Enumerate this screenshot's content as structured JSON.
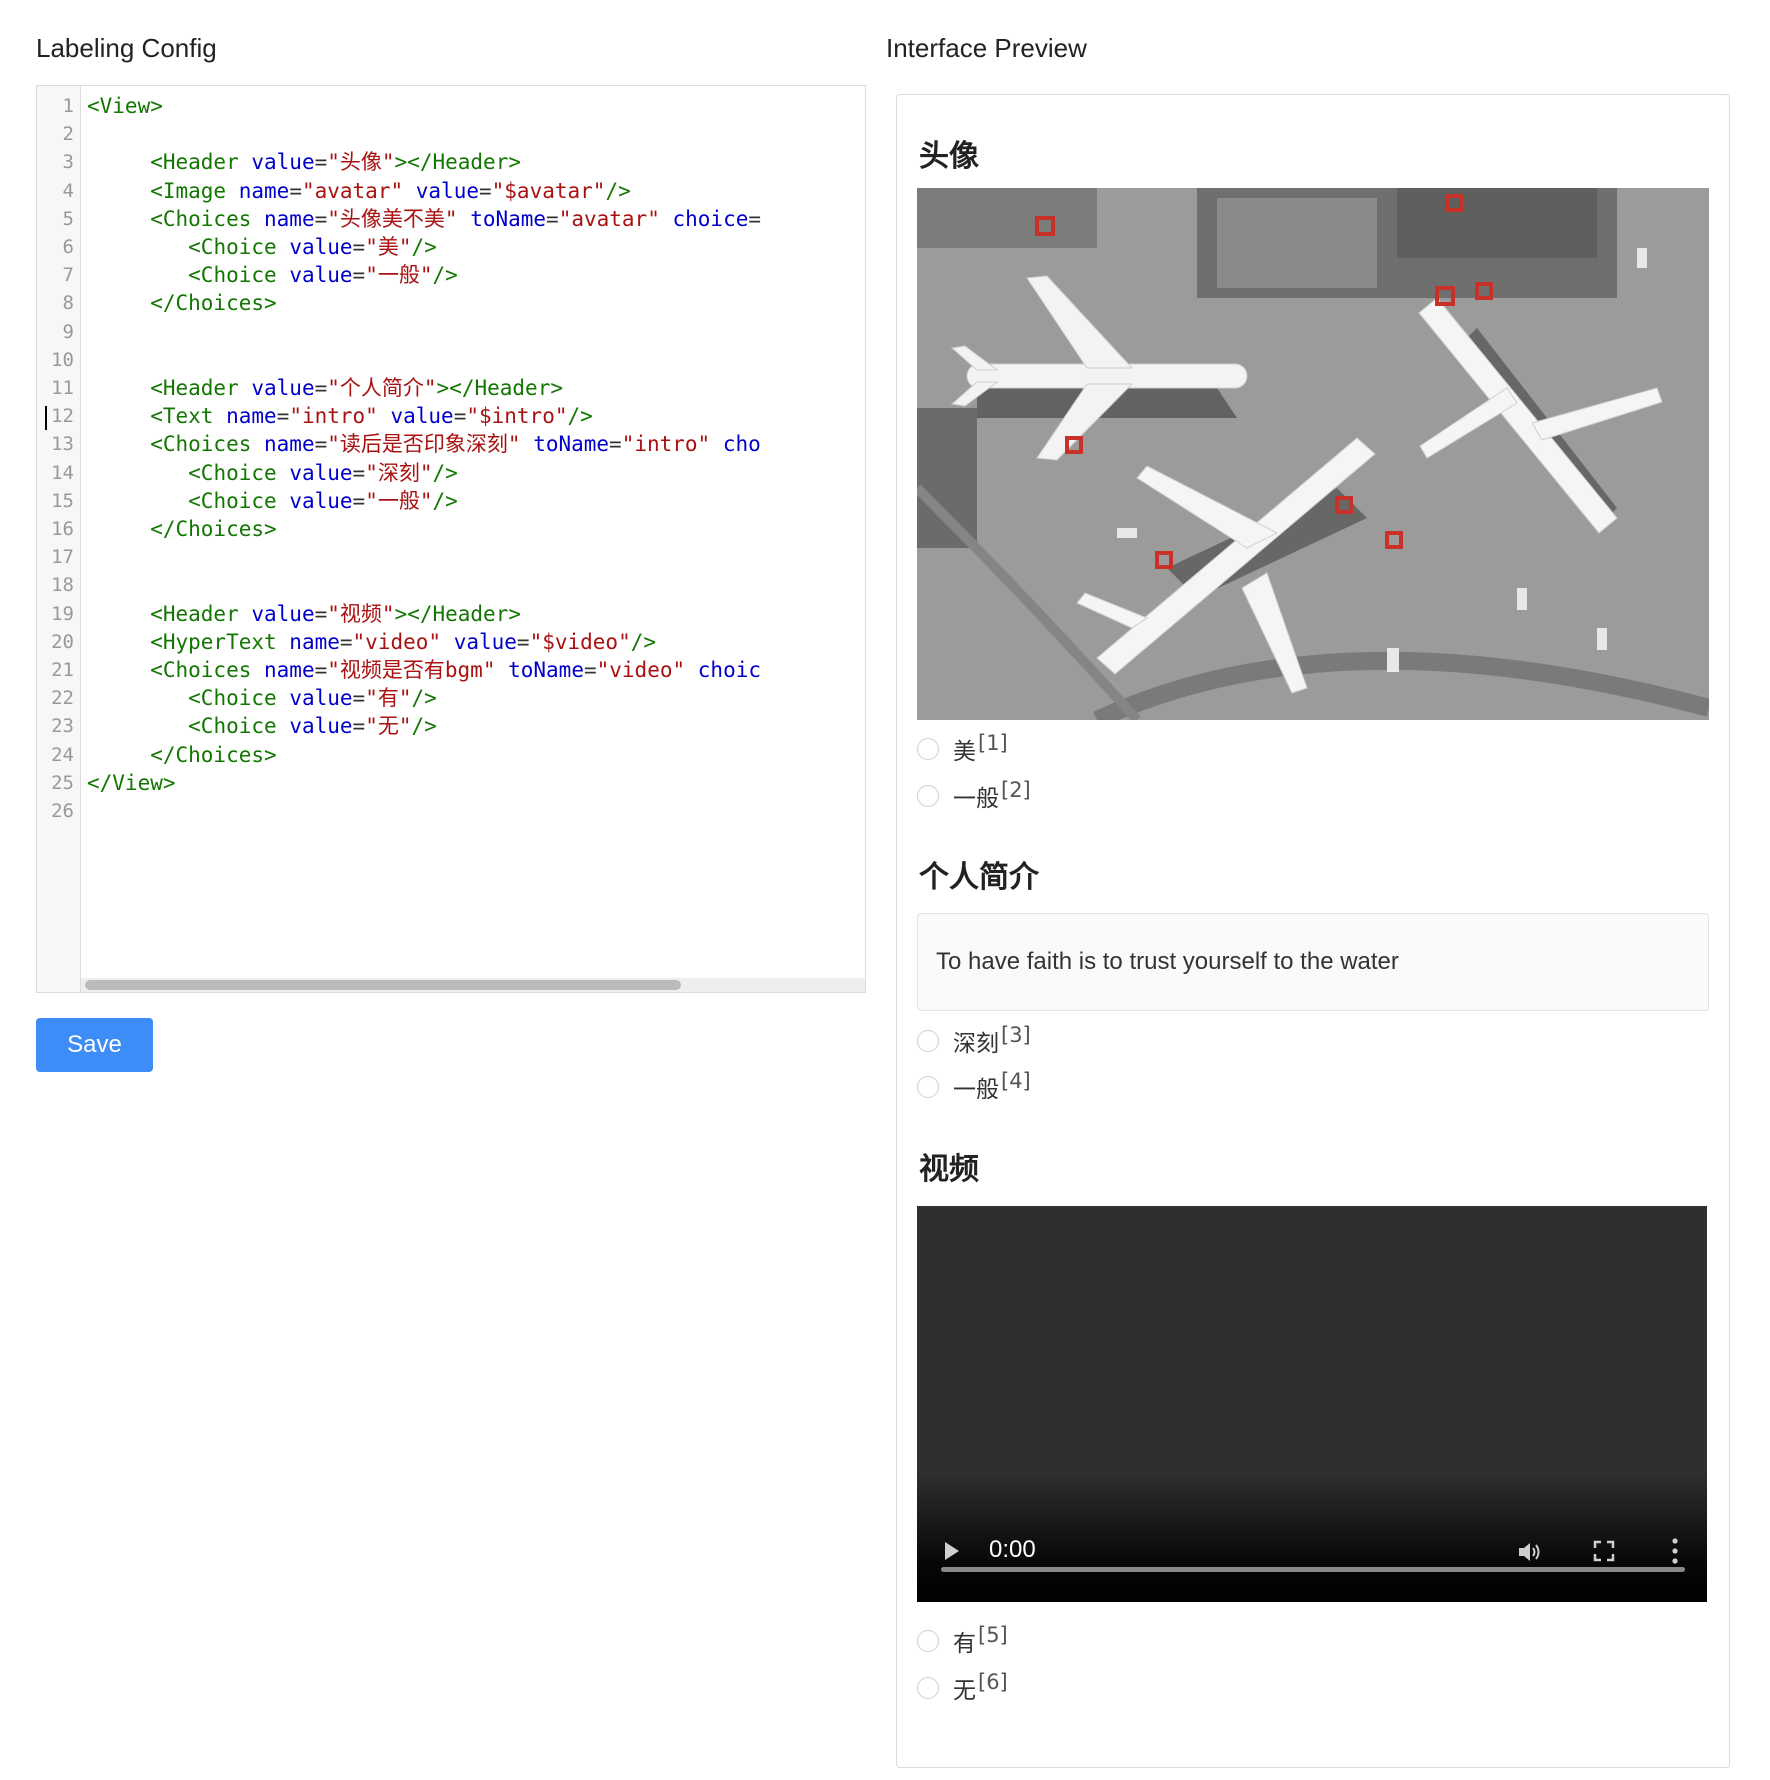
{
  "left": {
    "title": "Labeling Config",
    "save_label": "Save",
    "code_lines": [
      {
        "n": "1",
        "parts": [
          [
            "tag",
            "<View>"
          ]
        ]
      },
      {
        "n": "2",
        "parts": []
      },
      {
        "n": "3",
        "parts": [
          [
            "sp",
            "     "
          ],
          [
            "tag",
            "<Header "
          ],
          [
            "attr",
            "value"
          ],
          [
            "eq",
            "="
          ],
          [
            "str",
            "\"头像\""
          ],
          [
            "tag",
            "></Header>"
          ]
        ]
      },
      {
        "n": "4",
        "parts": [
          [
            "sp",
            "     "
          ],
          [
            "tag",
            "<Image "
          ],
          [
            "attr",
            "name"
          ],
          [
            "eq",
            "="
          ],
          [
            "str",
            "\"avatar\" "
          ],
          [
            "attr",
            "value"
          ],
          [
            "eq",
            "="
          ],
          [
            "str",
            "\"$avatar\""
          ],
          [
            "tag",
            "/>"
          ]
        ]
      },
      {
        "n": "5",
        "parts": [
          [
            "sp",
            "     "
          ],
          [
            "tag",
            "<Choices "
          ],
          [
            "attr",
            "name"
          ],
          [
            "eq",
            "="
          ],
          [
            "str",
            "\"头像美不美\" "
          ],
          [
            "attr",
            "toName"
          ],
          [
            "eq",
            "="
          ],
          [
            "str",
            "\"avatar\" "
          ],
          [
            "attr",
            "choice"
          ],
          [
            "eq",
            "="
          ]
        ]
      },
      {
        "n": "6",
        "parts": [
          [
            "sp",
            "        "
          ],
          [
            "tag",
            "<Choice "
          ],
          [
            "attr",
            "value"
          ],
          [
            "eq",
            "="
          ],
          [
            "str",
            "\"美\""
          ],
          [
            "tag",
            "/>"
          ]
        ]
      },
      {
        "n": "7",
        "parts": [
          [
            "sp",
            "        "
          ],
          [
            "tag",
            "<Choice "
          ],
          [
            "attr",
            "value"
          ],
          [
            "eq",
            "="
          ],
          [
            "str",
            "\"一般\""
          ],
          [
            "tag",
            "/>"
          ]
        ]
      },
      {
        "n": "8",
        "parts": [
          [
            "sp",
            "     "
          ],
          [
            "tag",
            "</Choices>"
          ]
        ]
      },
      {
        "n": "9",
        "parts": []
      },
      {
        "n": "10",
        "parts": []
      },
      {
        "n": "11",
        "parts": [
          [
            "sp",
            "     "
          ],
          [
            "tag",
            "<Header "
          ],
          [
            "attr",
            "value"
          ],
          [
            "eq",
            "="
          ],
          [
            "str",
            "\"个人简介\""
          ],
          [
            "tag",
            "></Header>"
          ]
        ]
      },
      {
        "n": "12",
        "parts": [
          [
            "sp",
            "     "
          ],
          [
            "tag",
            "<Text "
          ],
          [
            "attr",
            "name"
          ],
          [
            "eq",
            "="
          ],
          [
            "str",
            "\"intro\" "
          ],
          [
            "attr",
            "value"
          ],
          [
            "eq",
            "="
          ],
          [
            "str",
            "\"$intro\""
          ],
          [
            "tag",
            "/>"
          ]
        ]
      },
      {
        "n": "13",
        "parts": [
          [
            "sp",
            "     "
          ],
          [
            "tag",
            "<Choices "
          ],
          [
            "attr",
            "name"
          ],
          [
            "eq",
            "="
          ],
          [
            "str",
            "\"读后是否印象深刻\" "
          ],
          [
            "attr",
            "toName"
          ],
          [
            "eq",
            "="
          ],
          [
            "str",
            "\"intro\" "
          ],
          [
            "attr",
            "cho"
          ]
        ]
      },
      {
        "n": "14",
        "parts": [
          [
            "sp",
            "        "
          ],
          [
            "tag",
            "<Choice "
          ],
          [
            "attr",
            "value"
          ],
          [
            "eq",
            "="
          ],
          [
            "str",
            "\"深刻\""
          ],
          [
            "tag",
            "/>"
          ]
        ]
      },
      {
        "n": "15",
        "parts": [
          [
            "sp",
            "        "
          ],
          [
            "tag",
            "<Choice "
          ],
          [
            "attr",
            "value"
          ],
          [
            "eq",
            "="
          ],
          [
            "str",
            "\"一般\""
          ],
          [
            "tag",
            "/>"
          ]
        ]
      },
      {
        "n": "16",
        "parts": [
          [
            "sp",
            "     "
          ],
          [
            "tag",
            "</Choices>"
          ]
        ]
      },
      {
        "n": "17",
        "parts": []
      },
      {
        "n": "18",
        "parts": []
      },
      {
        "n": "19",
        "parts": [
          [
            "sp",
            "     "
          ],
          [
            "tag",
            "<Header "
          ],
          [
            "attr",
            "value"
          ],
          [
            "eq",
            "="
          ],
          [
            "str",
            "\"视频\""
          ],
          [
            "tag",
            "></Header>"
          ]
        ]
      },
      {
        "n": "20",
        "parts": [
          [
            "sp",
            "     "
          ],
          [
            "tag",
            "<HyperText "
          ],
          [
            "attr",
            "name"
          ],
          [
            "eq",
            "="
          ],
          [
            "str",
            "\"video\" "
          ],
          [
            "attr",
            "value"
          ],
          [
            "eq",
            "="
          ],
          [
            "str",
            "\"$video\""
          ],
          [
            "tag",
            "/>"
          ]
        ]
      },
      {
        "n": "21",
        "parts": [
          [
            "sp",
            "     "
          ],
          [
            "tag",
            "<Choices "
          ],
          [
            "attr",
            "name"
          ],
          [
            "eq",
            "="
          ],
          [
            "str",
            "\"视频是否有bgm\" "
          ],
          [
            "attr",
            "toName"
          ],
          [
            "eq",
            "="
          ],
          [
            "str",
            "\"video\" "
          ],
          [
            "attr",
            "choic"
          ]
        ]
      },
      {
        "n": "22",
        "parts": [
          [
            "sp",
            "        "
          ],
          [
            "tag",
            "<Choice "
          ],
          [
            "attr",
            "value"
          ],
          [
            "eq",
            "="
          ],
          [
            "str",
            "\"有\""
          ],
          [
            "tag",
            "/>"
          ]
        ]
      },
      {
        "n": "23",
        "parts": [
          [
            "sp",
            "        "
          ],
          [
            "tag",
            "<Choice "
          ],
          [
            "attr",
            "value"
          ],
          [
            "eq",
            "="
          ],
          [
            "str",
            "\"无\""
          ],
          [
            "tag",
            "/>"
          ]
        ]
      },
      {
        "n": "24",
        "parts": [
          [
            "sp",
            "     "
          ],
          [
            "tag",
            "</Choices>"
          ]
        ]
      },
      {
        "n": "25",
        "parts": [
          [
            "tag",
            "</View>"
          ]
        ]
      },
      {
        "n": "26",
        "parts": []
      }
    ]
  },
  "right": {
    "title": "Interface Preview",
    "sections": [
      {
        "header": "头像",
        "choices": [
          {
            "label": "美",
            "hotkey": "[1]"
          },
          {
            "label": "一般",
            "hotkey": "[2]"
          }
        ]
      },
      {
        "header": "个人简介",
        "text": "To have faith is to trust yourself to the water",
        "choices": [
          {
            "label": "深刻",
            "hotkey": "[3]"
          },
          {
            "label": "一般",
            "hotkey": "[4]"
          }
        ]
      },
      {
        "header": "视频",
        "video_time": "0:00",
        "choices": [
          {
            "label": "有",
            "hotkey": "[5]"
          },
          {
            "label": "无",
            "hotkey": "[6]"
          }
        ]
      }
    ]
  },
  "colors": {
    "tag": "#117700",
    "attr": "#0000cc",
    "string": "#aa1111",
    "save_button": "#3d8cf7"
  },
  "icons": {
    "video_play": "play-icon",
    "video_volume": "volume-icon",
    "video_fullscreen": "fullscreen-icon",
    "video_more": "more-vertical-icon"
  }
}
